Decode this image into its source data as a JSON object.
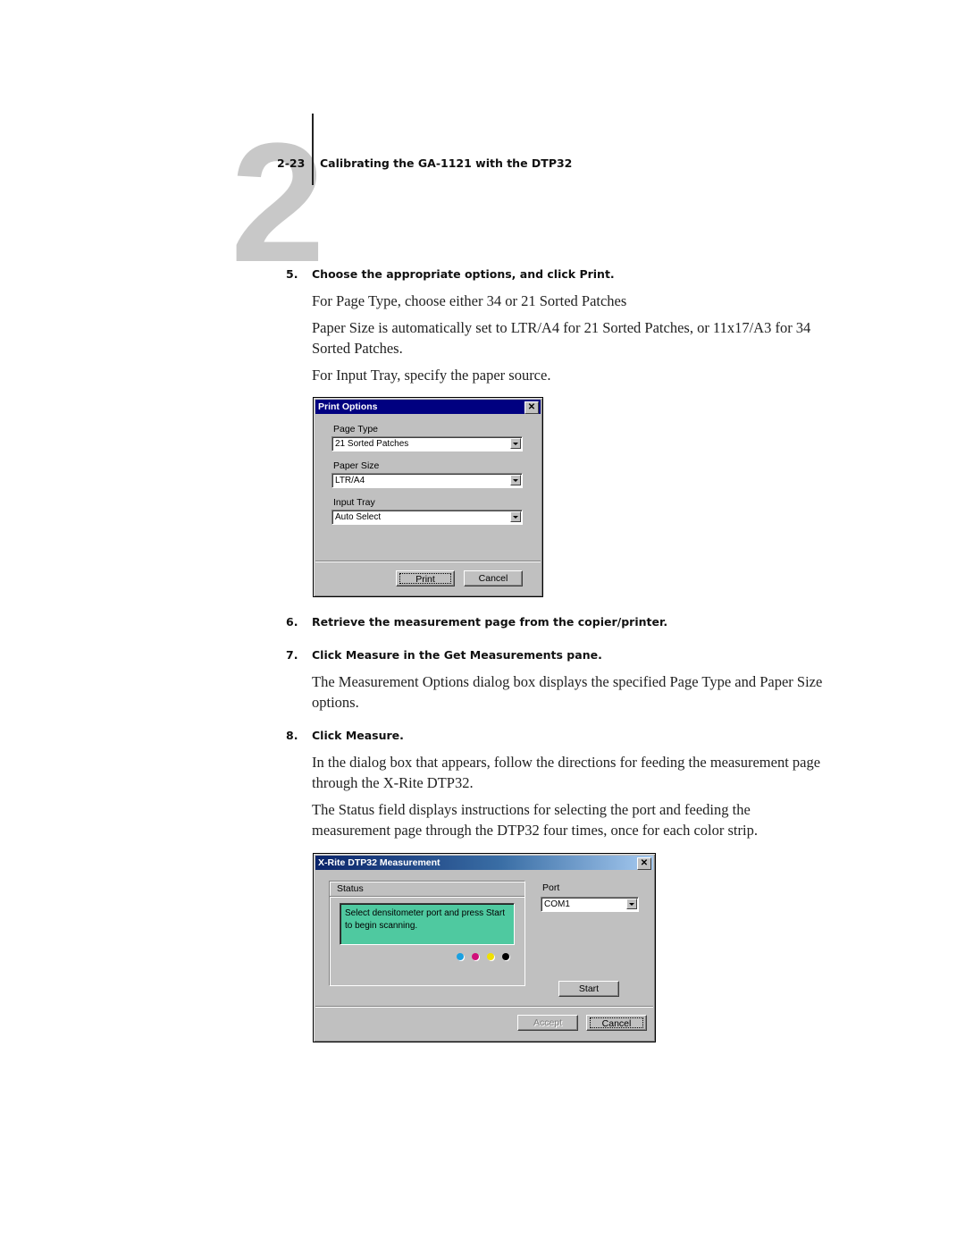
{
  "header": {
    "chapter_number": "2",
    "page_ref": "2-23",
    "running_title": "Calibrating the GA-1121 with the DTP32"
  },
  "steps": [
    {
      "num": "5.",
      "text": "Choose the appropriate options, and click Print."
    },
    {
      "num": "6.",
      "text": "Retrieve the measurement page from the copier/printer."
    },
    {
      "num": "7.",
      "text": "Click Measure in the Get Measurements pane."
    },
    {
      "num": "8.",
      "text": "Click Measure."
    }
  ],
  "paragraphs": {
    "p1": "For Page Type, choose either 34 or 21 Sorted Patches",
    "p2": "Paper Size is automatically set to LTR/A4 for 21 Sorted Patches, or 11x17/A3 for 34 Sorted Patches.",
    "p3": "For Input Tray, specify the paper source.",
    "p4": "The Measurement Options dialog box displays the specified Page Type and Paper Size options.",
    "p5": "In the dialog box that appears, follow the directions for feeding the measurement page through the X-Rite DTP32.",
    "p6": "The Status field displays instructions for selecting the port and feeding the measurement page through the DTP32 four times, once for each color strip."
  },
  "print_dialog": {
    "title": "Print Options",
    "close_icon": "close-icon",
    "page_type_label": "Page Type",
    "page_type_value": "21 Sorted Patches",
    "paper_size_label": "Paper Size",
    "paper_size_value": "LTR/A4",
    "input_tray_label": "Input Tray",
    "input_tray_value": "Auto Select",
    "print_button": "Print",
    "cancel_button": "Cancel"
  },
  "measure_dialog": {
    "title": "X-Rite DTP32 Measurement",
    "close_icon": "close-icon",
    "status_label": "Status",
    "status_text": "Select densitometer port and press Start to begin scanning.",
    "status_color": "#4fc9a0",
    "strip_dots": [
      {
        "name": "cyan",
        "color": "#1aa0e0"
      },
      {
        "name": "magenta",
        "color": "#d0107a"
      },
      {
        "name": "yellow",
        "color": "#f0e000"
      },
      {
        "name": "black",
        "color": "#000000"
      }
    ],
    "port_label": "Port",
    "port_value": "COM1",
    "start_button": "Start",
    "accept_button": "Accept",
    "cancel_button": "Cancel"
  }
}
